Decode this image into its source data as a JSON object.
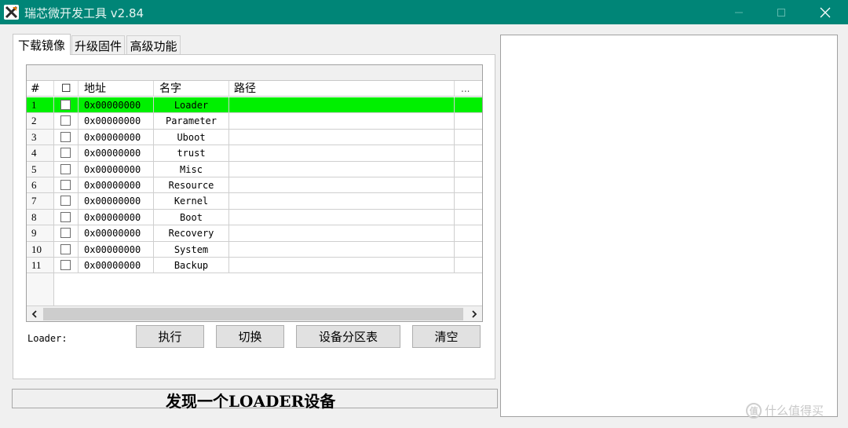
{
  "window": {
    "title": "瑞芯微开发工具 v2.84",
    "accent": "#008577"
  },
  "tabs": [
    {
      "label": "下载镜像",
      "active": true
    },
    {
      "label": "升级固件",
      "active": false
    },
    {
      "label": "高级功能",
      "active": false
    }
  ],
  "table": {
    "headers": {
      "index": "#",
      "check": "☐",
      "address": "地址",
      "name": "名字",
      "path": "路径",
      "more": "..."
    },
    "rows": [
      {
        "index": "1",
        "address": "0x00000000",
        "name": "Loader",
        "path": "",
        "selected": true
      },
      {
        "index": "2",
        "address": "0x00000000",
        "name": "Parameter",
        "path": ""
      },
      {
        "index": "3",
        "address": "0x00000000",
        "name": "Uboot",
        "path": ""
      },
      {
        "index": "4",
        "address": "0x00000000",
        "name": "trust",
        "path": ""
      },
      {
        "index": "5",
        "address": "0x00000000",
        "name": "Misc",
        "path": ""
      },
      {
        "index": "6",
        "address": "0x00000000",
        "name": "Resource",
        "path": ""
      },
      {
        "index": "7",
        "address": "0x00000000",
        "name": "Kernel",
        "path": ""
      },
      {
        "index": "8",
        "address": "0x00000000",
        "name": "Boot",
        "path": ""
      },
      {
        "index": "9",
        "address": "0x00000000",
        "name": "Recovery",
        "path": ""
      },
      {
        "index": "10",
        "address": "0x00000000",
        "name": "System",
        "path": ""
      },
      {
        "index": "11",
        "address": "0x00000000",
        "name": "Backup",
        "path": ""
      }
    ],
    "selected_color": "#00f000"
  },
  "controls": {
    "loader_label": "Loader:",
    "execute_label": "执行",
    "switch_label": "切换",
    "partition_label": "设备分区表",
    "clear_label": "清空"
  },
  "status": {
    "text": "发现一个LOADER设备"
  },
  "watermark": {
    "text": "什么值得买",
    "mark": "值"
  }
}
